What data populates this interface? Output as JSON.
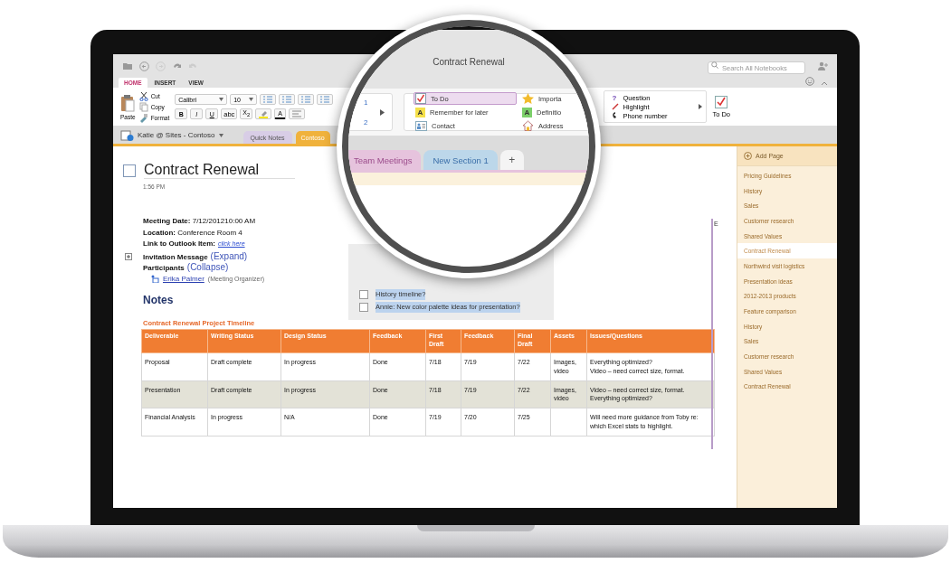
{
  "window": {
    "title": "Contract Renewal",
    "search": {
      "placeholder": "Search All Notebooks"
    }
  },
  "ribbon_tabs": [
    {
      "label": "HOME",
      "selected": true
    },
    {
      "label": "INSERT",
      "selected": false
    },
    {
      "label": "VIEW",
      "selected": false
    }
  ],
  "clipboard": {
    "paste": "Paste",
    "items": [
      {
        "label": "Cut",
        "kind": "cut"
      },
      {
        "label": "Copy",
        "kind": "copy"
      },
      {
        "label": "Format",
        "kind": "format"
      }
    ]
  },
  "font": {
    "name": "Calibri",
    "size": "10"
  },
  "format_buttons": [
    {
      "label": "B",
      "kind": "bold"
    },
    {
      "label": "I",
      "kind": "italic"
    },
    {
      "label": "U",
      "kind": "underline"
    },
    {
      "label": "abc",
      "kind": "strike"
    },
    {
      "label": "X$_{2}$",
      "kind": "subscript"
    }
  ],
  "font_color": {
    "label": "A"
  },
  "style_gallery": [
    "1",
    "2"
  ],
  "tags_gallery": [
    {
      "label": "To Do",
      "kind": "todo",
      "selected": true
    },
    {
      "label": "Importa",
      "kind": "star",
      "selected": false
    },
    {
      "label": "Remember for later",
      "kind": "letter",
      "badge": "A",
      "color": "#f5e04a",
      "selected": false
    },
    {
      "label": "Definitio",
      "kind": "letter",
      "badge": "A",
      "color": "#7ccf6a",
      "selected": false
    },
    {
      "label": "Contact",
      "kind": "contact",
      "selected": false
    },
    {
      "label": "Address",
      "kind": "house",
      "selected": false
    }
  ],
  "tags_gallery_more": [
    {
      "label": "Question",
      "kind": "question",
      "badge": "?"
    },
    {
      "label": "Highlight",
      "kind": "pen"
    },
    {
      "label": "Phone number",
      "kind": "phone"
    }
  ],
  "todo_button": {
    "label": "To Do"
  },
  "notebook": {
    "name": "Katie @ Sites - Contoso"
  },
  "notebook_tabs": [
    {
      "label": "Quick Notes",
      "color": "#d8cde6",
      "selected": false
    },
    {
      "label": "Contoso",
      "color": "#f0b23c",
      "selected": true
    }
  ],
  "section_tabs": [
    {
      "label": "Team Meetings",
      "color": "#e6c3dd",
      "selected": true,
      "kind": "section"
    },
    {
      "label": "New Section 1",
      "color": "#bcd7ea",
      "selected": false,
      "kind": "section"
    },
    {
      "label": "+",
      "kind": "add",
      "selected": false
    }
  ],
  "page": {
    "title": "Contract Renewal",
    "checked": false,
    "time": "1:56 PM",
    "details": [
      {
        "text": "**Meeting Date:** 7/12/201210:00 AM"
      },
      {
        "text": "**Location:** Conference Room 4"
      },
      {
        "text": "**Link to Outlook Item:**",
        "link": "click here"
      },
      {
        "text": "**Invitation Message**",
        "action": "(Expand)",
        "expander": true
      },
      {
        "text": "**Participants**",
        "action": "(Collapse)"
      }
    ],
    "participant": {
      "name": "Erika Palmer",
      "role": "(Meeting Organizer)"
    },
    "heading": "Notes",
    "table_title": "Contract Renewal Project Timeline"
  },
  "tasks": [
    {
      "text": "History timeline?",
      "checked": false
    },
    {
      "text": "Annie: New color palette ideas for presentation?",
      "checked": false
    }
  ],
  "table": {
    "columns": [
      "Deliverable",
      "Writing Status",
      "Design Status",
      "Feedback",
      "First Draft",
      "Feedback",
      "Final Draft",
      "Assets",
      "Issues/Questions"
    ],
    "rows": [
      {
        "shaded": false,
        "cells": [
          "Proposal",
          "Draft complete",
          "In progress",
          "Done",
          "7/18",
          "7/19",
          "7/22",
          "Images, video",
          "Everything optimized?\nVideo – need correct size, format."
        ]
      },
      {
        "shaded": true,
        "cells": [
          "Presentation",
          "Draft complete",
          "In progress",
          "Done",
          "7/18",
          "7/19",
          "7/22",
          "Images, video",
          "Video – need correct size, format.\nEverything optimized?"
        ]
      },
      {
        "shaded": false,
        "cells": [
          "Financial Analysis",
          "In progress",
          "N/A",
          "Done",
          "7/19",
          "7/20",
          "7/25",
          "",
          "Will need more guidance from Toby re: which Excel stats to highlight."
        ]
      }
    ]
  },
  "margin_mark": "E",
  "sidebar": {
    "add_page": "Add Page",
    "pages": [
      {
        "label": "Pricing Guidelines",
        "selected": false
      },
      {
        "label": "History",
        "selected": false
      },
      {
        "label": "Sales",
        "selected": false
      },
      {
        "label": "Customer research",
        "selected": false
      },
      {
        "label": "Shared Values",
        "selected": false
      },
      {
        "label": "Contract Renewal",
        "selected": true
      },
      {
        "label": "Northwind visit logistics",
        "selected": false
      },
      {
        "label": "Presentation ideas",
        "selected": false
      },
      {
        "label": "2012-2013 products",
        "selected": false
      },
      {
        "label": "Feature comparison",
        "selected": false
      },
      {
        "label": "History",
        "selected": false
      },
      {
        "label": "Sales",
        "selected": false
      },
      {
        "label": "Customer research",
        "selected": false
      },
      {
        "label": "Shared Values",
        "selected": false
      },
      {
        "label": "Contract Renewal",
        "selected": false
      }
    ]
  }
}
